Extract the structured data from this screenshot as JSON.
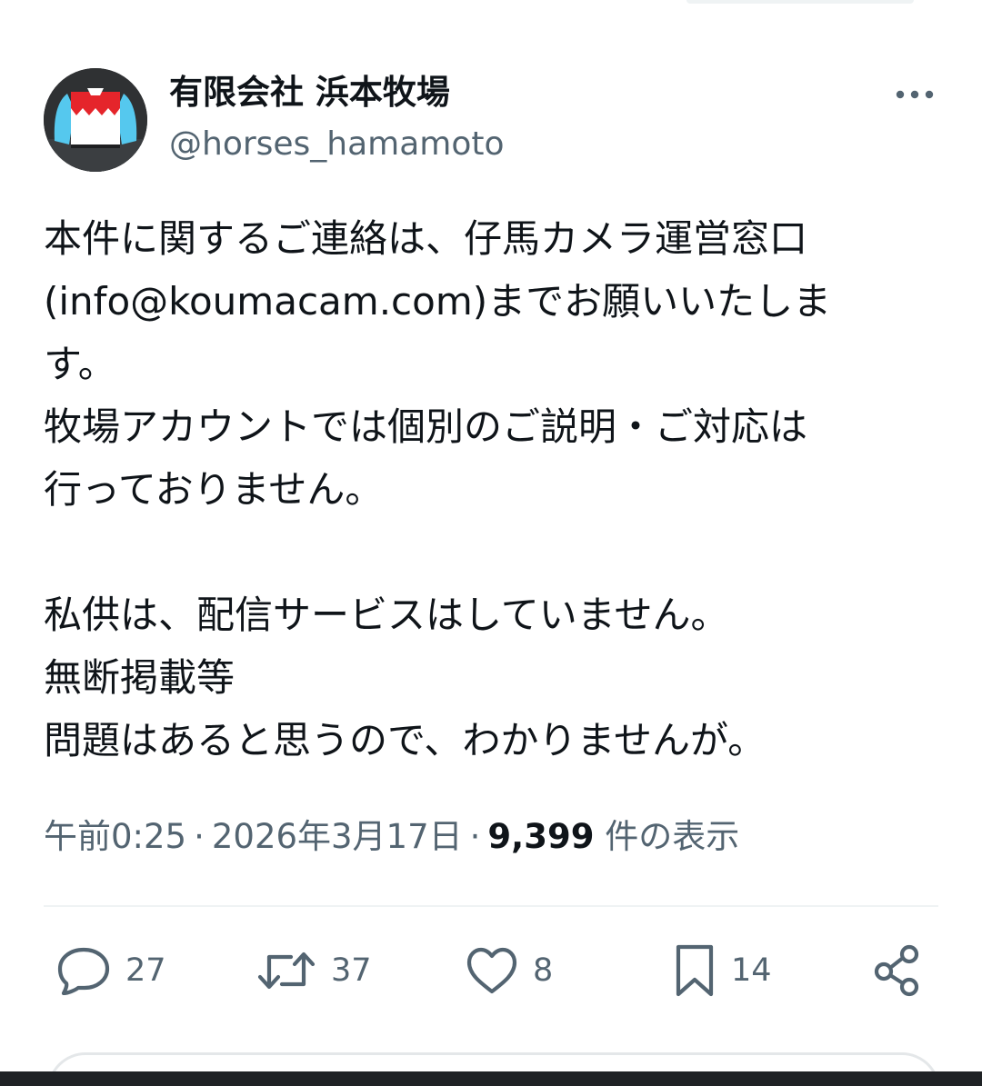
{
  "author": {
    "display_name": "有限会社 浜本牧場",
    "handle": "@horses_hamamoto",
    "avatar_icon": "jockey-silks-avatar-icon"
  },
  "menu": {
    "more_icon": "more-dots-icon"
  },
  "tweet": {
    "lines": [
      "本件に関するご連絡は、仔馬カメラ運営窓口",
      "(info@koumacam.com)までお願いいたしま",
      "す。",
      "牧場アカウントでは個別のご説明・ご対応は",
      "行っておりません。",
      "",
      "私供は、配信サービスはしていません。",
      "無断掲載等",
      "問題はあると思うので、わかりませんが。"
    ]
  },
  "meta": {
    "time": "午前0:25",
    "date": "2026年3月17日",
    "views_count": "9,399",
    "views_label": "件の表示",
    "separator": "·"
  },
  "actions": {
    "reply": {
      "icon": "reply-icon",
      "count": "27"
    },
    "retweet": {
      "icon": "retweet-icon",
      "count": "37"
    },
    "like": {
      "icon": "heart-icon",
      "count": "8"
    },
    "bookmark": {
      "icon": "bookmark-icon",
      "count": "14"
    },
    "share": {
      "icon": "share-icon"
    }
  },
  "colors": {
    "text": "#0f1419",
    "secondary": "#536471",
    "divider": "#eff3f4",
    "avatar_blue": "#55c8ee",
    "avatar_red": "#e5252b"
  }
}
